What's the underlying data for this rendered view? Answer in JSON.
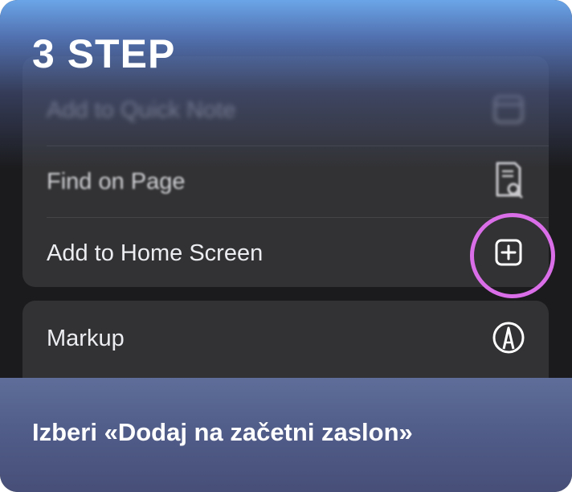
{
  "step": {
    "title": "3  STEP"
  },
  "menu": {
    "items": [
      {
        "label": "Add to Quick Note",
        "icon": "quick-note-icon"
      },
      {
        "label": "Find on Page",
        "icon": "find-on-page-icon"
      },
      {
        "label": "Add to Home Screen",
        "icon": "add-square-icon"
      }
    ],
    "items2": [
      {
        "label": "Markup",
        "icon": "markup-pen-icon"
      }
    ]
  },
  "highlight": {
    "color": "#d96ee8",
    "target": "add-square-icon"
  },
  "instruction": {
    "text": "Izberi «Dodaj na začetni zaslon»"
  },
  "colors": {
    "accent_top": "#6ca8ec",
    "panel_bottom": "#5e6d99",
    "menu_bg": "#323234"
  }
}
